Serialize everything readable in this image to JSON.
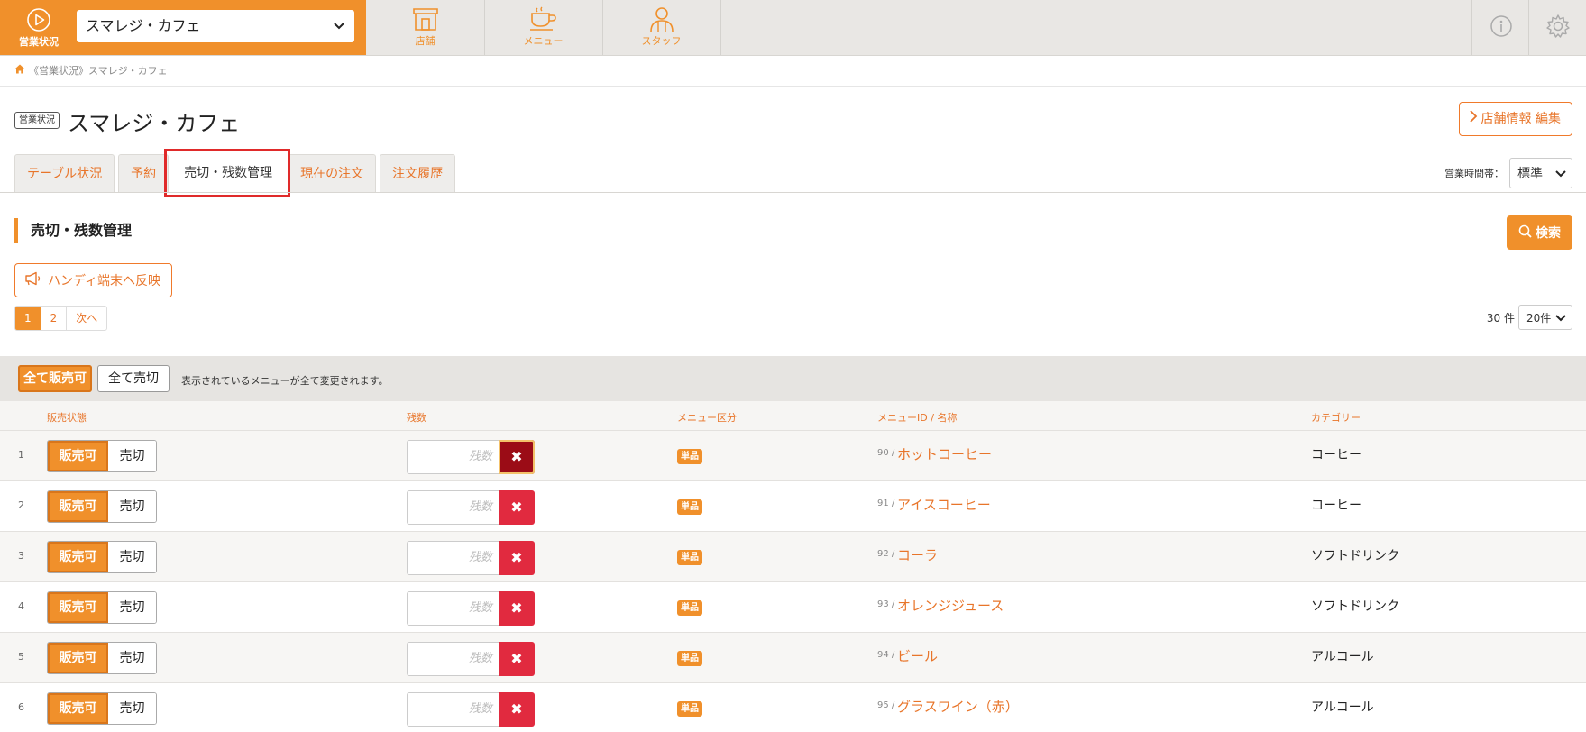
{
  "nav": {
    "status_label": "営業状況",
    "shop_select_value": "スマレジ・カフェ",
    "items": [
      {
        "label": "店舗",
        "icon": "store-icon"
      },
      {
        "label": "メニュー",
        "icon": "menu-cup-icon"
      },
      {
        "label": "スタッフ",
        "icon": "staff-icon"
      }
    ],
    "right_icons": [
      "info-icon",
      "gear-icon"
    ],
    "accent": "#f0902b"
  },
  "breadcrumb": "《営業状況》スマレジ・カフェ",
  "header": {
    "badge": "営業状況",
    "title": "スマレジ・カフェ",
    "edit_button": "店舗情報 編集"
  },
  "tabs": [
    {
      "label": "テーブル状況",
      "active": false
    },
    {
      "label": "予約",
      "active": false
    },
    {
      "label": "売切・残数管理",
      "active": true
    },
    {
      "label": "現在の注文",
      "active": false
    },
    {
      "label": "注文履歴",
      "active": false
    }
  ],
  "hours": {
    "label": "営業時間帯：",
    "value": "標準"
  },
  "section": {
    "title": "売切・残数管理",
    "search_button": "検索",
    "handy_button": "ハンディ端末へ反映"
  },
  "pagination": {
    "pages": [
      "1",
      "2"
    ],
    "next": "次へ",
    "current": "1"
  },
  "count": {
    "total": "30 件",
    "per_page": "20件"
  },
  "bulk": {
    "all_available": "全て販売可",
    "all_soldout": "全て売切",
    "note": "表示されているメニューが全て変更されます。"
  },
  "columns": {
    "status": "販売状態",
    "stock": "残数",
    "type": "メニュー区分",
    "id_name": "メニューID / 名称",
    "category": "カテゴリー"
  },
  "rows": [
    {
      "index": "1",
      "on": "販売可",
      "off": "売切",
      "stock_placeholder": "残数",
      "type": "単品",
      "menu_id": "90 /",
      "name": "ホットコーヒー",
      "category": "コーヒー"
    },
    {
      "index": "2",
      "on": "販売可",
      "off": "売切",
      "stock_placeholder": "残数",
      "type": "単品",
      "menu_id": "91 /",
      "name": "アイスコーヒー",
      "category": "コーヒー"
    },
    {
      "index": "3",
      "on": "販売可",
      "off": "売切",
      "stock_placeholder": "残数",
      "type": "単品",
      "menu_id": "92 /",
      "name": "コーラ",
      "category": "ソフトドリンク"
    },
    {
      "index": "4",
      "on": "販売可",
      "off": "売切",
      "stock_placeholder": "残数",
      "type": "単品",
      "menu_id": "93 /",
      "name": "オレンジジュース",
      "category": "ソフトドリンク"
    },
    {
      "index": "5",
      "on": "販売可",
      "off": "売切",
      "stock_placeholder": "残数",
      "type": "単品",
      "menu_id": "94 /",
      "name": "ビール",
      "category": "アルコール"
    },
    {
      "index": "6",
      "on": "販売可",
      "off": "売切",
      "stock_placeholder": "残数",
      "type": "単品",
      "menu_id": "95 /",
      "name": "グラスワイン（赤）",
      "category": "アルコール"
    }
  ]
}
